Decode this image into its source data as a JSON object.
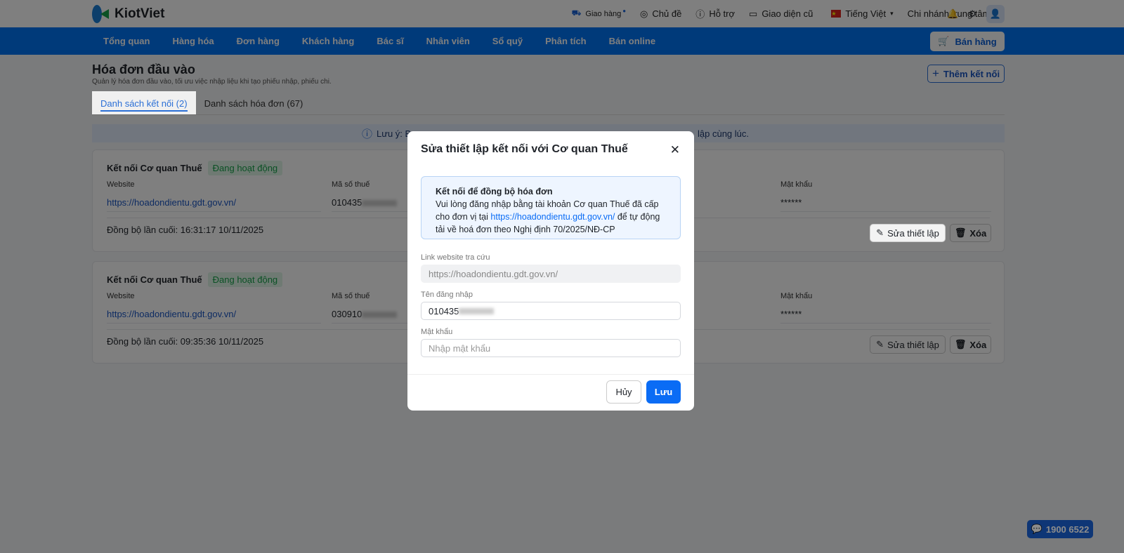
{
  "header": {
    "brand": "KiotViet",
    "items": [
      {
        "label": "Giao hàng",
        "icon": "delivery-icon"
      },
      {
        "label": "Chủ đề",
        "icon": "palette-icon"
      },
      {
        "label": "Hỗ trợ",
        "icon": "support-icon"
      },
      {
        "label": "Giao diện cũ",
        "icon": "monitor-icon"
      }
    ],
    "language": "Tiếng Việt",
    "branch": "Chi nhánh trung tâm"
  },
  "nav": {
    "items": [
      "Tổng quan",
      "Hàng hóa",
      "Đơn hàng",
      "Khách hàng",
      "Bác sĩ",
      "Nhân viên",
      "Sổ quỹ",
      "Phân tích",
      "Bán online"
    ],
    "sell_label": "Bán hàng",
    "accent": "#0074f4"
  },
  "page": {
    "title": "Hóa đơn đầu vào",
    "subtitle": "Quản lý hóa đơn đầu vào, tối ưu việc nhập liệu khi tạo phiếu nhập, phiếu chi.",
    "add_label": "Thêm kết nối",
    "tabs": [
      {
        "label": "Danh sách kết nối (2)",
        "active": true
      },
      {
        "label": "Danh sách hóa đơn (67)",
        "active": false
      }
    ],
    "note_start": "Lưu ý: B",
    "note_end": "lập cùng lúc."
  },
  "cards": [
    {
      "title": "Kết nối Cơ quan Thuế",
      "status": "Đang hoạt động",
      "website_label": "Website",
      "website": "https://hoadondientu.gdt.gov.vn/",
      "tax_label": "Mã số thuế",
      "tax": "010435",
      "password_label": "Mật khẩu",
      "password": "******",
      "sync": "Đồng bộ lần cuối: 16:31:17 10/11/2025",
      "edit_label": "Sửa thiết lập",
      "delete_label": "Xóa"
    },
    {
      "title": "Kết nối Cơ quan Thuế",
      "status": "Đang hoạt động",
      "website_label": "Website",
      "website": "https://hoadondientu.gdt.gov.vn/",
      "tax_label": "Mã số thuế",
      "tax": "030910",
      "password_label": "Mật khẩu",
      "password": "******",
      "sync": "Đồng bộ lần cuối: 09:35:36 10/11/2025",
      "edit_label": "Sửa thiết lập",
      "delete_label": "Xóa"
    }
  ],
  "modal": {
    "title": "Sửa thiết lập kết nối với Cơ quan Thuế",
    "info_title": "Kết nối để đồng bộ hóa đơn",
    "info_pre": "Vui lòng đăng nhập bằng tài khoản Cơ quan Thuế đã cấp cho đơn vị tại ",
    "info_link": "https://hoadondientu.gdt.gov.vn/",
    "info_post": " để tự động tải về hoá đơn theo Nghị định 70/2025/NĐ-CP",
    "link_label": "Link website tra cứu",
    "link_value": "https://hoadondientu.gdt.gov.vn/",
    "user_label": "Tên đăng nhập",
    "user_value": "010435",
    "pass_label": "Mật khẩu",
    "pass_placeholder": "Nhập mật khẩu",
    "cancel": "Hủy",
    "save": "Lưu"
  },
  "hotline": "1900 6522"
}
